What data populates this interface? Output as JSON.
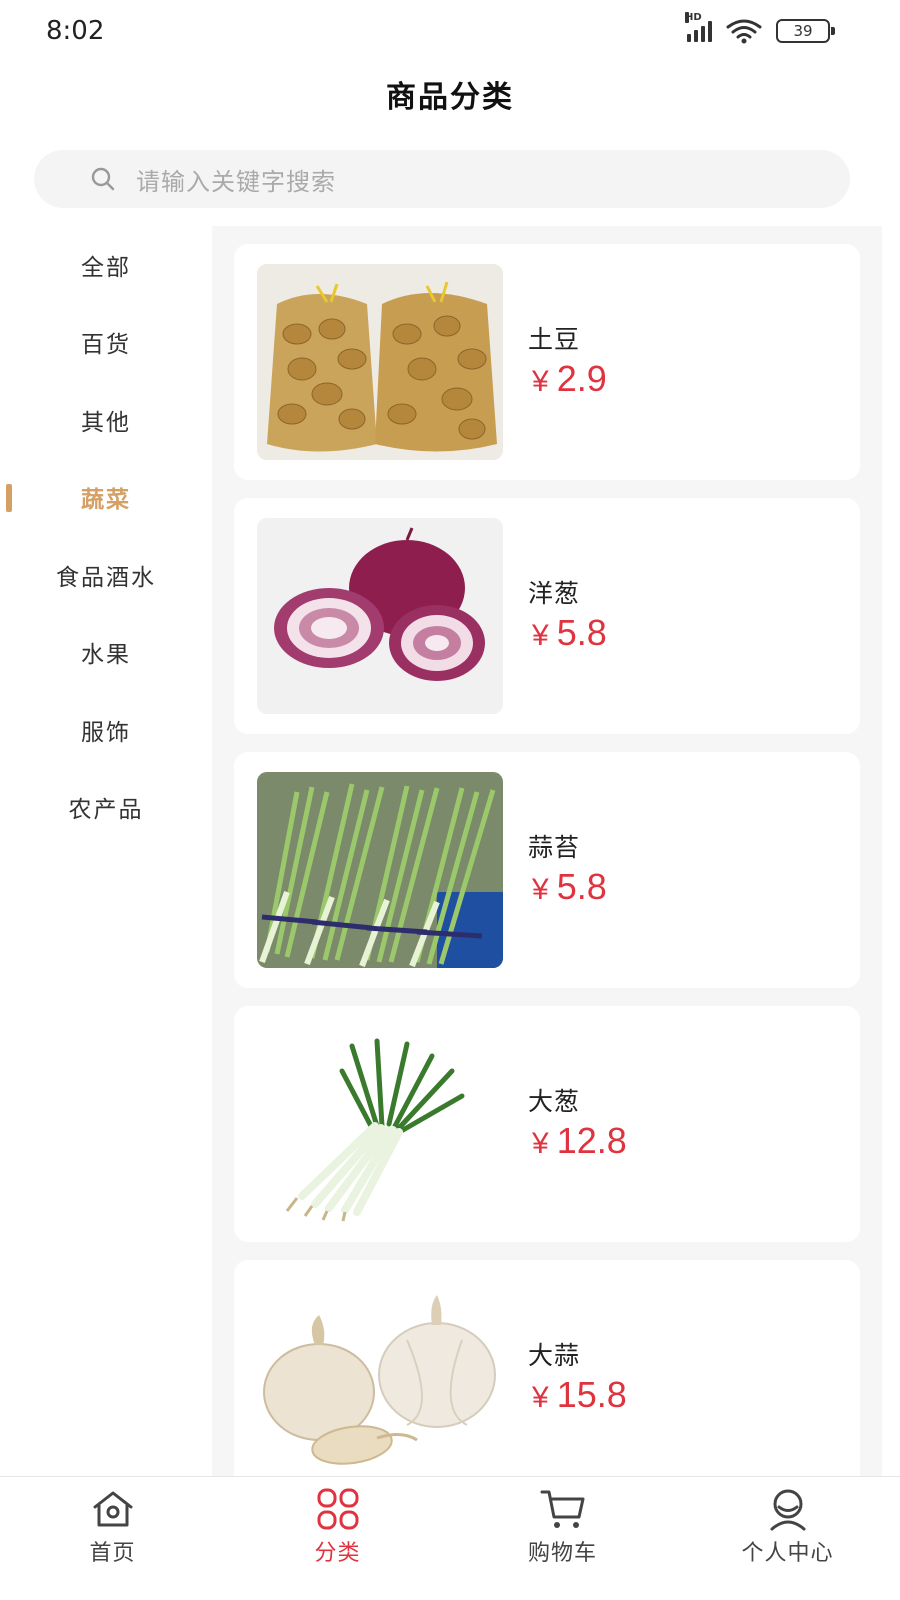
{
  "status_bar": {
    "time": "8:02",
    "battery": "39",
    "network_label": "HD"
  },
  "header": {
    "title": "商品分类"
  },
  "search": {
    "placeholder": "请输入关键字搜索"
  },
  "sidebar": {
    "items": [
      {
        "label": "全部",
        "active": false
      },
      {
        "label": "百货",
        "active": false
      },
      {
        "label": "其他",
        "active": false
      },
      {
        "label": "蔬菜",
        "active": true
      },
      {
        "label": "食品酒水",
        "active": false
      },
      {
        "label": "水果",
        "active": false
      },
      {
        "label": "服饰",
        "active": false
      },
      {
        "label": "农产品",
        "active": false
      }
    ]
  },
  "products": [
    {
      "name": "土豆",
      "currency": "¥",
      "price": "2.9",
      "image_icon": "potato-image"
    },
    {
      "name": "洋葱",
      "currency": "¥",
      "price": "5.8",
      "image_icon": "onion-image"
    },
    {
      "name": "蒜苔",
      "currency": "¥",
      "price": "5.8",
      "image_icon": "garlic-scape-image"
    },
    {
      "name": "大葱",
      "currency": "¥",
      "price": "12.8",
      "image_icon": "scallion-image"
    },
    {
      "name": "大蒜",
      "currency": "¥",
      "price": "15.8",
      "image_icon": "garlic-image"
    }
  ],
  "tab_bar": {
    "tabs": [
      {
        "label": "首页",
        "icon": "home-icon",
        "active": false
      },
      {
        "label": "分类",
        "icon": "category-icon",
        "active": true
      },
      {
        "label": "购物车",
        "icon": "cart-icon",
        "active": false
      },
      {
        "label": "个人中心",
        "icon": "profile-icon",
        "active": false
      }
    ]
  },
  "colors": {
    "accent": "#d4a063",
    "price": "#e03340",
    "active_tab": "#e03340",
    "panel_bg": "#f6f6f6"
  }
}
